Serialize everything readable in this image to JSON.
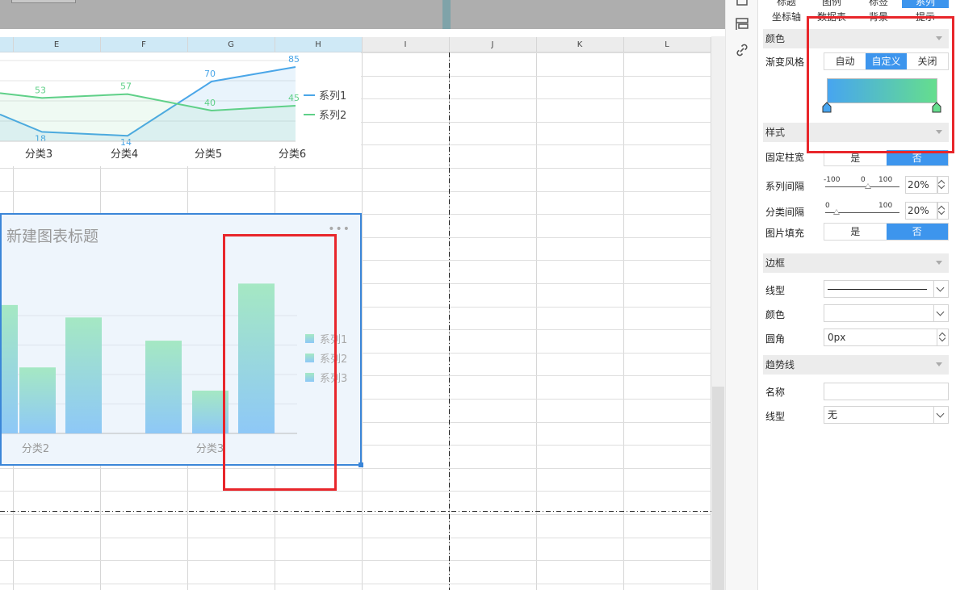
{
  "sheet": {
    "columns": [
      "E",
      "F",
      "G",
      "H",
      "I",
      "J",
      "K",
      "L"
    ]
  },
  "chart_line": {
    "type": "line",
    "categories": [
      "分类3",
      "分类4",
      "分类5",
      "分类6"
    ],
    "series": [
      {
        "name": "系列1",
        "values": [
          18,
          14,
          70,
          85
        ],
        "color": "#4aa6e8"
      },
      {
        "name": "系列2",
        "values": [
          53,
          57,
          40,
          45
        ],
        "color": "#5fd088"
      }
    ],
    "ylim": [
      0,
      100
    ],
    "legend_position": "right",
    "grid": true
  },
  "chart_bar": {
    "type": "bar",
    "title": "新建图表标题",
    "categories": [
      "分类2",
      "分类3"
    ],
    "series": [
      {
        "name": "系列1",
        "values": [
          72,
          52
        ]
      },
      {
        "name": "系列2",
        "values": [
          37,
          24
        ]
      },
      {
        "name": "系列3",
        "values": [
          65,
          84
        ]
      }
    ],
    "ylim": [
      0,
      100
    ],
    "legend_position": "right",
    "gradient": [
      "#a5e8c3",
      "#8ec8f7"
    ],
    "grid": true
  },
  "panel": {
    "tabs_row1": [
      "标题",
      "图例",
      "标签",
      "系列"
    ],
    "tabs_row2": [
      "坐标轴",
      "数据表",
      "背景",
      "提示"
    ],
    "active_tab": "系列",
    "color_section": "颜色",
    "gradient_label": "渐变风格",
    "gradient_options": [
      "自动",
      "自定义",
      "关闭"
    ],
    "gradient_selected": "自定义",
    "gradient_colors": [
      "#47a5f0",
      "#65de8d"
    ],
    "style_section": "样式",
    "fixed_width_label": "固定柱宽",
    "yes": "是",
    "no": "否",
    "series_gap_label": "系列间隔",
    "series_gap_ticks": [
      "-100",
      "0",
      "100"
    ],
    "series_gap_value": "20%",
    "series_gap_slider": 20,
    "category_gap_label": "分类间隔",
    "category_gap_ticks": [
      "0",
      "100"
    ],
    "category_gap_value": "20%",
    "category_gap_slider": 20,
    "image_fill_label": "图片填充",
    "border_section": "边框",
    "line_type_label": "线型",
    "border_color_label": "颜色",
    "corner_label": "圆角",
    "corner_value": "0px",
    "trend_section": "趋势线",
    "name_label": "名称",
    "name_value": "",
    "trend_line_label": "线型",
    "trend_line_value": "无"
  }
}
